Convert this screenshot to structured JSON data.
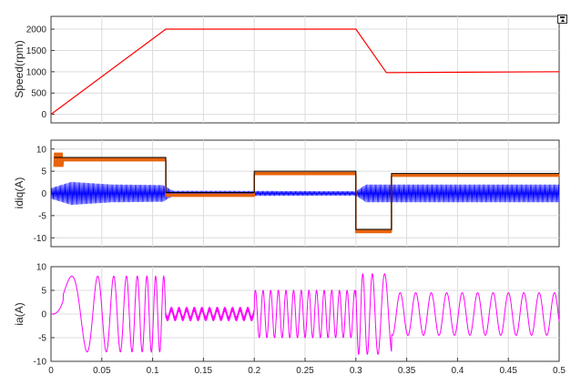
{
  "toolbar": {
    "dock_icon": "undock-figure-icon"
  },
  "colors": {
    "speed": "#ff0000",
    "id": "#0000ff",
    "iq": "#e8640e",
    "iq_ref": "#000000",
    "ia": "#ff00ff"
  },
  "chart_data": [
    {
      "type": "line",
      "ylabel": "Speed(rpm)",
      "xlim": [
        0,
        0.5
      ],
      "ylim": [
        -200,
        2300
      ],
      "yticks": [
        0,
        500,
        1000,
        1500,
        2000
      ],
      "grid": true,
      "series": [
        {
          "color": "#ff0000",
          "x": [
            0,
            0.113,
            0.3,
            0.33,
            0.5
          ],
          "y": [
            0,
            2000,
            2000,
            980,
            1000
          ]
        }
      ]
    },
    {
      "type": "line",
      "ylabel": "idiq(A)",
      "xlim": [
        0,
        0.5
      ],
      "ylim": [
        -12,
        12
      ],
      "yticks": [
        -10,
        -5,
        0,
        5,
        10
      ],
      "grid": true,
      "series": [
        {
          "color": "#000000",
          "segments": [
            [
              0.003,
              0.113,
              8.1
            ],
            [
              0.113,
              0.2,
              0.2
            ],
            [
              0.2,
              0.3,
              5.0
            ],
            [
              0.3,
              0.335,
              -8.1
            ],
            [
              0.335,
              0.5,
              4.5
            ]
          ]
        },
        {
          "color": "#e8640e",
          "segments": [
            [
              0.003,
              0.113,
              7.6
            ],
            [
              0.113,
              0.2,
              -0.4
            ],
            [
              0.2,
              0.3,
              4.5
            ],
            [
              0.3,
              0.335,
              -8.6
            ],
            [
              0.335,
              0.5,
              4.1
            ]
          ]
        },
        {
          "color": "#0000ff",
          "center": 0,
          "envelope": [
            [
              0.0,
              1.2
            ],
            [
              0.02,
              2.6
            ],
            [
              0.06,
              2.0
            ],
            [
              0.11,
              1.9
            ],
            [
              0.12,
              0.6
            ],
            [
              0.3,
              0.5
            ],
            [
              0.31,
              2.0
            ],
            [
              0.5,
              2.0
            ]
          ]
        }
      ]
    },
    {
      "type": "line",
      "ylabel": "ia(A)",
      "xlim": [
        0,
        0.5
      ],
      "ylim": [
        -10,
        10
      ],
      "yticks": [
        -10,
        -5,
        0,
        5,
        10
      ],
      "xticks": [
        "0",
        "0.05",
        "0.1",
        "0.15",
        "0.2",
        "0.25",
        "0.3",
        "0.35",
        "0.4",
        "0.45",
        "0.5"
      ],
      "grid": true,
      "series": [
        {
          "color": "#ff00ff",
          "amplitude_by_segment": [
            [
              0,
              0.113,
              8
            ],
            [
              0.113,
              0.2,
              1
            ],
            [
              0.2,
              0.3,
              5
            ],
            [
              0.3,
              0.335,
              8.5
            ],
            [
              0.335,
              0.5,
              4.5
            ]
          ]
        }
      ]
    }
  ]
}
